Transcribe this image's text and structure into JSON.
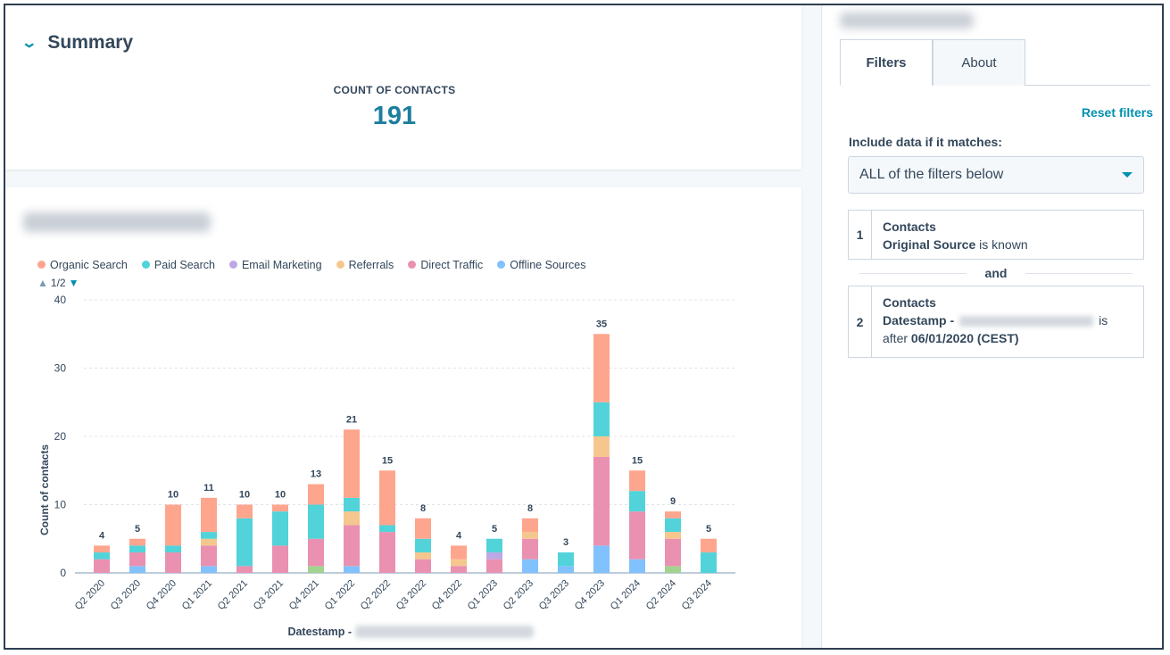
{
  "summary": {
    "title": "Summary",
    "kpi_label": "COUNT OF CONTACTS",
    "kpi_value": "191"
  },
  "legend": {
    "items": [
      {
        "label": "Organic Search",
        "color": "#fea58e"
      },
      {
        "label": "Paid Search",
        "color": "#51d3d9"
      },
      {
        "label": "Email Marketing",
        "color": "#bda7e5"
      },
      {
        "label": "Referrals",
        "color": "#f5c78e"
      },
      {
        "label": "Direct Traffic",
        "color": "#ea90b1"
      },
      {
        "label": "Offline Sources",
        "color": "#81c1fd"
      }
    ],
    "page": "1/2"
  },
  "chart_data": {
    "type": "bar",
    "stacked": true,
    "ylabel": "Count of contacts",
    "xlabel": "Datestamp -",
    "ylim": [
      0,
      40
    ],
    "yticks": [
      0,
      10,
      20,
      30,
      40
    ],
    "grid": true,
    "legend_position": "top-left",
    "categories": [
      "Q2 2020",
      "Q3 2020",
      "Q4 2020",
      "Q1 2021",
      "Q2 2021",
      "Q3 2021",
      "Q4 2021",
      "Q1 2022",
      "Q2 2022",
      "Q3 2022",
      "Q4 2022",
      "Q1 2023",
      "Q2 2023",
      "Q3 2023",
      "Q4 2023",
      "Q1 2024",
      "Q2 2024",
      "Q3 2024"
    ],
    "totals": [
      4,
      5,
      10,
      11,
      10,
      10,
      13,
      21,
      15,
      8,
      4,
      5,
      8,
      3,
      35,
      15,
      9,
      5
    ],
    "series": [
      {
        "name": "Offline Sources",
        "color": "#81c1fd",
        "values": [
          0,
          1,
          0,
          1,
          0,
          0,
          0,
          1,
          0,
          0,
          0,
          0,
          2,
          1,
          4,
          2,
          0,
          0
        ]
      },
      {
        "color": "#a2d28f",
        "values": [
          0,
          0,
          0,
          0,
          0,
          0,
          1,
          0,
          0,
          0,
          0,
          0,
          0,
          0,
          0,
          0,
          1,
          0
        ]
      },
      {
        "name": "Direct Traffic",
        "color": "#ea90b1",
        "values": [
          2,
          2,
          3,
          3,
          1,
          4,
          4,
          6,
          6,
          2,
          1,
          2,
          3,
          0,
          13,
          7,
          4,
          0
        ]
      },
      {
        "name": "Email Marketing",
        "color": "#bda7e5",
        "values": [
          0,
          0,
          0,
          0,
          0,
          0,
          0,
          0,
          0,
          0,
          0,
          1,
          0,
          0,
          0,
          0,
          0,
          0
        ]
      },
      {
        "name": "Referrals",
        "color": "#f5c78e",
        "values": [
          0,
          0,
          0,
          1,
          0,
          0,
          0,
          2,
          0,
          1,
          1,
          0,
          1,
          0,
          3,
          0,
          1,
          0
        ]
      },
      {
        "name": "Paid Search",
        "color": "#51d3d9",
        "values": [
          1,
          1,
          1,
          1,
          7,
          5,
          5,
          2,
          1,
          2,
          0,
          2,
          0,
          2,
          5,
          3,
          2,
          3
        ]
      },
      {
        "name": "Organic Search",
        "color": "#fea58e",
        "values": [
          1,
          1,
          6,
          5,
          2,
          1,
          3,
          10,
          8,
          3,
          2,
          0,
          2,
          0,
          10,
          3,
          1,
          2
        ]
      }
    ]
  },
  "panel": {
    "tabs": [
      {
        "label": "Filters",
        "active": true
      },
      {
        "label": "About",
        "active": false
      }
    ],
    "reset": "Reset filters",
    "include_label": "Include data if it matches:",
    "match_select": "ALL of the filters below",
    "filters": [
      {
        "num": "1",
        "object": "Contacts",
        "property": "Original Source",
        "op": "is known"
      },
      {
        "num": "2",
        "object": "Contacts",
        "property": "Datestamp -",
        "op": "is",
        "op2": "after",
        "value": "06/01/2020 (CEST)"
      }
    ],
    "and_label": "and"
  }
}
